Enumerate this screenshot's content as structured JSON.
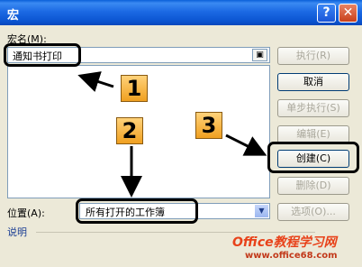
{
  "window": {
    "title": "宏",
    "help_glyph": "?",
    "close_glyph": "✕"
  },
  "macro_name": {
    "label": "宏名(M):",
    "value": "通知书打印"
  },
  "location": {
    "label": "位置(A):",
    "value": "所有打开的工作簿"
  },
  "description": {
    "label": "说明"
  },
  "buttons": [
    {
      "label": "执行(R)",
      "enabled": false
    },
    {
      "label": "取消",
      "enabled": true
    },
    {
      "label": "单步执行(S)",
      "enabled": false
    },
    {
      "label": "编辑(E)",
      "enabled": false
    },
    {
      "label": "创建(C)",
      "enabled": true
    },
    {
      "label": "删除(D)",
      "enabled": false
    },
    {
      "label": "选项(O)...",
      "enabled": false
    }
  ],
  "callouts": [
    "1",
    "2",
    "3"
  ],
  "watermark": {
    "line1": "Office教程学习网",
    "line2": "www.office68.com"
  },
  "colors": {
    "title_bar": "#0a5fd8",
    "dialog_bg": "#ece9d8",
    "badge": "#f0a020",
    "watermark": "#e8421a"
  }
}
